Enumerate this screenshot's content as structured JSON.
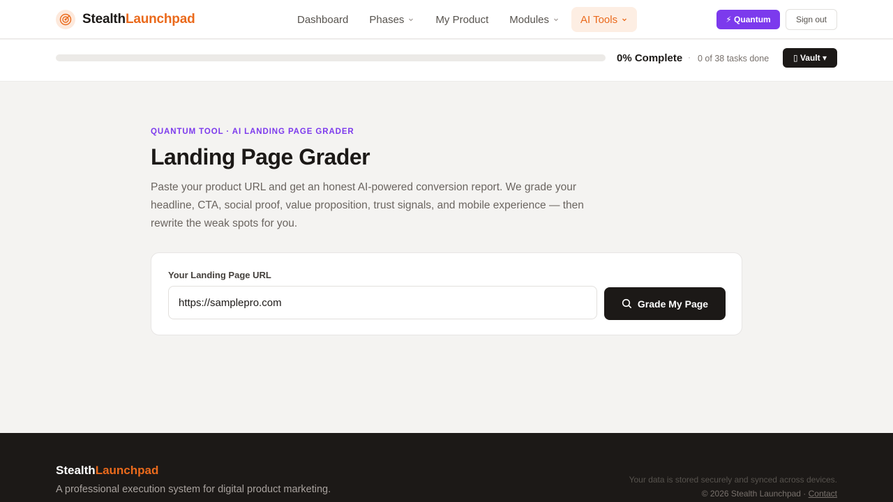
{
  "brand": {
    "name_part1": "Stealth",
    "name_part2": "Launchpad",
    "logo_icon": "target-icon"
  },
  "nav": {
    "items": [
      {
        "label": "Dashboard",
        "has_dropdown": false,
        "active": false
      },
      {
        "label": "Phases",
        "has_dropdown": true,
        "active": false
      },
      {
        "label": "My Product",
        "has_dropdown": false,
        "active": false
      },
      {
        "label": "Modules",
        "has_dropdown": true,
        "active": false
      },
      {
        "label": "AI Tools",
        "has_dropdown": true,
        "active": true
      }
    ]
  },
  "header_actions": {
    "quantum_label": "⚡ Quantum",
    "signout_label": "Sign out"
  },
  "progress": {
    "percent": 0,
    "percent_label": "0% Complete",
    "separator": "·",
    "tasks_label": "0 of 38 tasks done",
    "vault_label": "▯ Vault ▾"
  },
  "main": {
    "eyebrow": "QUANTUM TOOL · AI LANDING PAGE GRADER",
    "title": "Landing Page Grader",
    "description": "Paste your product URL and get an honest AI-powered conversion report. We grade your headline, CTA, social proof, value proposition, trust signals, and mobile experience — then rewrite the weak spots for you."
  },
  "form": {
    "label": "Your Landing Page URL",
    "url_value": "https://samplepro.com",
    "button_label": "Grade My Page"
  },
  "footer": {
    "brand_part1": "Stealth",
    "brand_part2": "Launchpad",
    "tagline": "A professional execution system for digital product marketing.",
    "secure_note": "Your data is stored securely and synced across devices.",
    "copyright": "© 2026 Stealth Launchpad · ",
    "contact_label": "Contact"
  },
  "colors": {
    "accent_orange": "#ea6a1c",
    "accent_purple": "#7c3aed",
    "dark": "#1c1917",
    "background": "#f4f3f1"
  }
}
